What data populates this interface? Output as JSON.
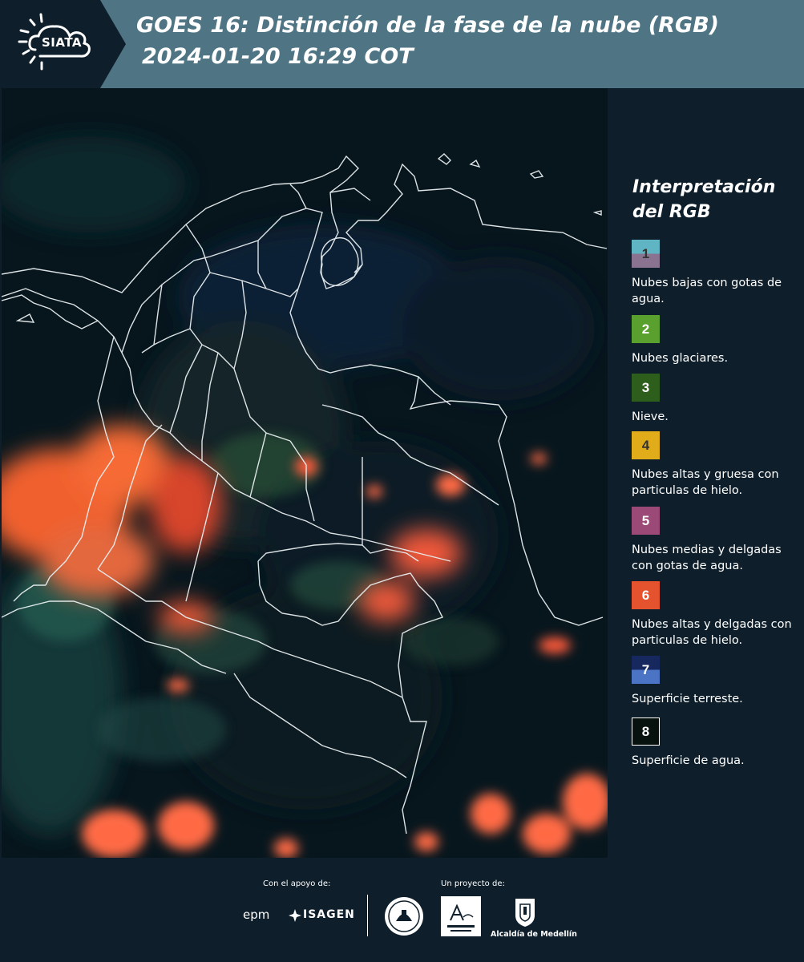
{
  "header": {
    "logo_text": "SIATA",
    "title_line1": "GOES 16: Distinción de la fase de la nube (RGB)",
    "title_line2": "2024-01-20 16:29 COT",
    "background_color": "#4f7584"
  },
  "map": {
    "description_icon": "satellite-rgb-map"
  },
  "legend": {
    "title_line1": "Interpretación",
    "title_line2": "del RGB",
    "items": [
      {
        "number": "1",
        "label": "Nubes bajas con gotas de agua.",
        "color_top": "#5fb5c4",
        "color_bottom": "#8a7391"
      },
      {
        "number": "2",
        "label": "Nubes glaciares.",
        "color": "#5aa02e"
      },
      {
        "number": "3",
        "label": "Nieve.",
        "color": "#2e5e1c"
      },
      {
        "number": "4",
        "label": "Nubes altas y gruesa con particulas de hielo.",
        "color": "#e1ac1a"
      },
      {
        "number": "5",
        "label": "Nubes medias y delgadas con gotas de agua.",
        "color": "#9b4a78"
      },
      {
        "number": "6",
        "label": "Nubes altas y delgadas con particulas de hielo.",
        "color": "#e4532e"
      },
      {
        "number": "7",
        "label": "Superficie terreste.",
        "color_top": "#16285e",
        "color_bottom": "#4b74c4"
      },
      {
        "number": "8",
        "label": "Superficie de agua.",
        "color": "#07120e"
      }
    ]
  },
  "footer": {
    "support_label": "Con el apoyo de:",
    "project_label": "Un proyecto de:",
    "epm": "epm",
    "isagen": "ISAGEN",
    "alcaldia": "Alcaldía de Medellín"
  }
}
